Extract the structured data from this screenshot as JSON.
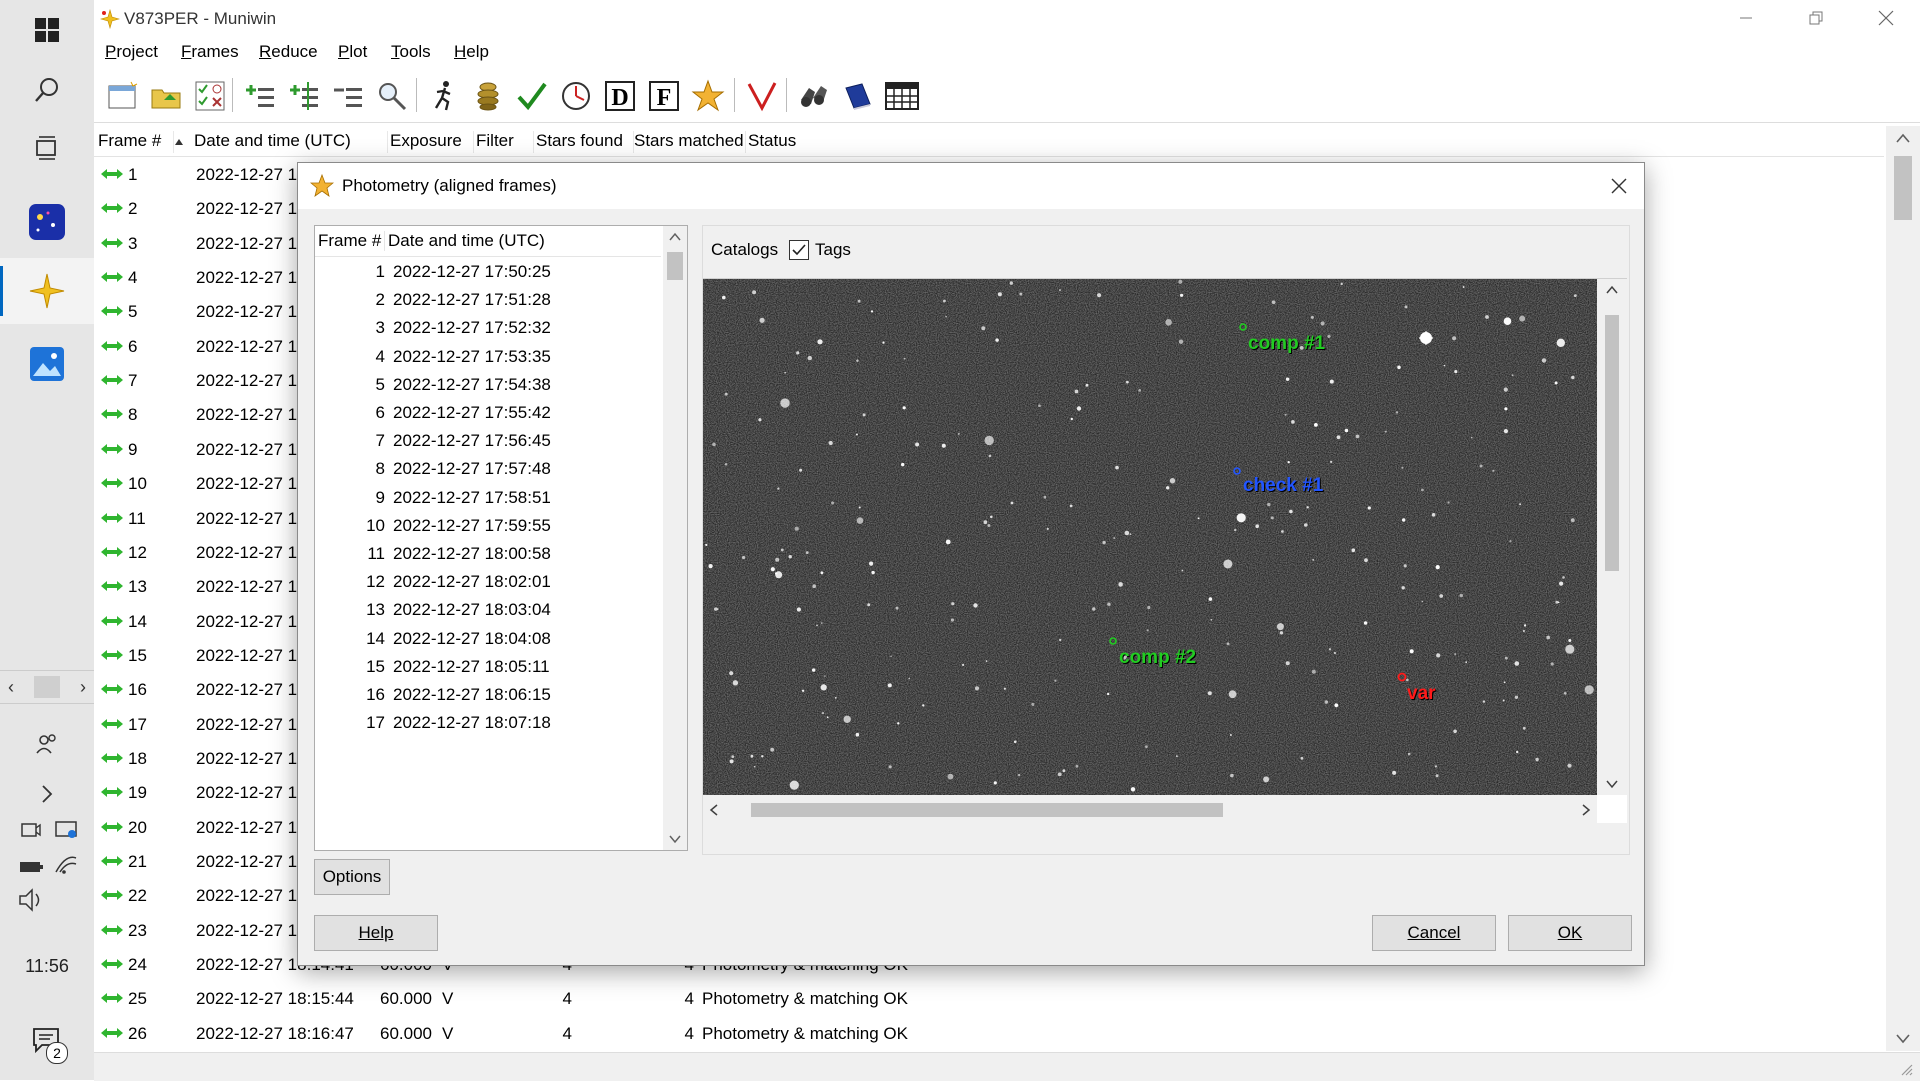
{
  "window": {
    "title": "V873PER - Muniwin",
    "menu": [
      {
        "label": "Project",
        "u": "P",
        "rest": "roject"
      },
      {
        "label": "Frames",
        "u": "F",
        "rest": "rames"
      },
      {
        "label": "Reduce",
        "u": "R",
        "rest": "educe"
      },
      {
        "label": "Plot",
        "u": "P",
        "rest": "lot"
      },
      {
        "label": "Tools",
        "u": "T",
        "rest": "ools"
      },
      {
        "label": "Help",
        "u": "H",
        "rest": "elp"
      }
    ]
  },
  "taskbar": {
    "clock": "11:56",
    "notification_count": "2"
  },
  "frames_table": {
    "headers": [
      "Frame #",
      "Date and time (UTC)",
      "Exposure",
      "Filter",
      "Stars found",
      "Stars matched",
      "Status"
    ],
    "rows": [
      {
        "frame": "1",
        "datetime": "2022-12-27 1",
        "exposure": "",
        "filter": "",
        "stars_found": "",
        "stars_matched": "",
        "status": ""
      },
      {
        "frame": "2",
        "datetime": "2022-12-27 1",
        "exposure": "",
        "filter": "",
        "stars_found": "",
        "stars_matched": "",
        "status": ""
      },
      {
        "frame": "3",
        "datetime": "2022-12-27 1",
        "exposure": "",
        "filter": "",
        "stars_found": "",
        "stars_matched": "",
        "status": ""
      },
      {
        "frame": "4",
        "datetime": "2022-12-27 1",
        "exposure": "",
        "filter": "",
        "stars_found": "",
        "stars_matched": "",
        "status": ""
      },
      {
        "frame": "5",
        "datetime": "2022-12-27 1",
        "exposure": "",
        "filter": "",
        "stars_found": "",
        "stars_matched": "",
        "status": ""
      },
      {
        "frame": "6",
        "datetime": "2022-12-27 1",
        "exposure": "",
        "filter": "",
        "stars_found": "",
        "stars_matched": "",
        "status": ""
      },
      {
        "frame": "7",
        "datetime": "2022-12-27 1",
        "exposure": "",
        "filter": "",
        "stars_found": "",
        "stars_matched": "",
        "status": ""
      },
      {
        "frame": "8",
        "datetime": "2022-12-27 1",
        "exposure": "",
        "filter": "",
        "stars_found": "",
        "stars_matched": "",
        "status": ""
      },
      {
        "frame": "9",
        "datetime": "2022-12-27 1",
        "exposure": "",
        "filter": "",
        "stars_found": "",
        "stars_matched": "",
        "status": ""
      },
      {
        "frame": "10",
        "datetime": "2022-12-27 1",
        "exposure": "",
        "filter": "",
        "stars_found": "",
        "stars_matched": "",
        "status": ""
      },
      {
        "frame": "11",
        "datetime": "2022-12-27 1",
        "exposure": "",
        "filter": "",
        "stars_found": "",
        "stars_matched": "",
        "status": ""
      },
      {
        "frame": "12",
        "datetime": "2022-12-27 1",
        "exposure": "",
        "filter": "",
        "stars_found": "",
        "stars_matched": "",
        "status": ""
      },
      {
        "frame": "13",
        "datetime": "2022-12-27 1",
        "exposure": "",
        "filter": "",
        "stars_found": "",
        "stars_matched": "",
        "status": ""
      },
      {
        "frame": "14",
        "datetime": "2022-12-27 1",
        "exposure": "",
        "filter": "",
        "stars_found": "",
        "stars_matched": "",
        "status": ""
      },
      {
        "frame": "15",
        "datetime": "2022-12-27 1",
        "exposure": "",
        "filter": "",
        "stars_found": "",
        "stars_matched": "",
        "status": ""
      },
      {
        "frame": "16",
        "datetime": "2022-12-27 1",
        "exposure": "",
        "filter": "",
        "stars_found": "",
        "stars_matched": "",
        "status": ""
      },
      {
        "frame": "17",
        "datetime": "2022-12-27 1",
        "exposure": "",
        "filter": "",
        "stars_found": "",
        "stars_matched": "",
        "status": ""
      },
      {
        "frame": "18",
        "datetime": "2022-12-27 1",
        "exposure": "",
        "filter": "",
        "stars_found": "",
        "stars_matched": "",
        "status": ""
      },
      {
        "frame": "19",
        "datetime": "2022-12-27 1",
        "exposure": "",
        "filter": "",
        "stars_found": "",
        "stars_matched": "",
        "status": ""
      },
      {
        "frame": "20",
        "datetime": "2022-12-27 1",
        "exposure": "",
        "filter": "",
        "stars_found": "",
        "stars_matched": "",
        "status": ""
      },
      {
        "frame": "21",
        "datetime": "2022-12-27 1",
        "exposure": "",
        "filter": "",
        "stars_found": "",
        "stars_matched": "",
        "status": ""
      },
      {
        "frame": "22",
        "datetime": "2022-12-27 1",
        "exposure": "",
        "filter": "",
        "stars_found": "",
        "stars_matched": "",
        "status": ""
      },
      {
        "frame": "23",
        "datetime": "2022-12-27 1",
        "exposure": "",
        "filter": "",
        "stars_found": "",
        "stars_matched": "",
        "status": ""
      },
      {
        "frame": "24",
        "datetime": "2022-12-27 18:14:41",
        "exposure": "60.000",
        "filter": "V",
        "stars_found": "4",
        "stars_matched": "4",
        "status": "Photometry & matching OK"
      },
      {
        "frame": "25",
        "datetime": "2022-12-27 18:15:44",
        "exposure": "60.000",
        "filter": "V",
        "stars_found": "4",
        "stars_matched": "4",
        "status": "Photometry & matching OK"
      },
      {
        "frame": "26",
        "datetime": "2022-12-27 18:16:47",
        "exposure": "60.000",
        "filter": "V",
        "stars_found": "4",
        "stars_matched": "4",
        "status": "Photometry & matching OK"
      }
    ]
  },
  "dialog": {
    "title": "Photometry (aligned frames)",
    "list_headers": [
      "Frame #",
      "Date and time (UTC)"
    ],
    "list_rows": [
      {
        "n": "1",
        "dt": "2022-12-27 17:50:25"
      },
      {
        "n": "2",
        "dt": "2022-12-27 17:51:28"
      },
      {
        "n": "3",
        "dt": "2022-12-27 17:52:32"
      },
      {
        "n": "4",
        "dt": "2022-12-27 17:53:35"
      },
      {
        "n": "5",
        "dt": "2022-12-27 17:54:38"
      },
      {
        "n": "6",
        "dt": "2022-12-27 17:55:42"
      },
      {
        "n": "7",
        "dt": "2022-12-27 17:56:45"
      },
      {
        "n": "8",
        "dt": "2022-12-27 17:57:48"
      },
      {
        "n": "9",
        "dt": "2022-12-27 17:58:51"
      },
      {
        "n": "10",
        "dt": "2022-12-27 17:59:55"
      },
      {
        "n": "11",
        "dt": "2022-12-27 18:00:58"
      },
      {
        "n": "12",
        "dt": "2022-12-27 18:02:01"
      },
      {
        "n": "13",
        "dt": "2022-12-27 18:03:04"
      },
      {
        "n": "14",
        "dt": "2022-12-27 18:04:08"
      },
      {
        "n": "15",
        "dt": "2022-12-27 18:05:11"
      },
      {
        "n": "16",
        "dt": "2022-12-27 18:06:15"
      },
      {
        "n": "17",
        "dt": "2022-12-27 18:07:18"
      }
    ],
    "catalogs_label": "Catalogs",
    "tags_label": "Tags",
    "tags_checked": true,
    "tags": [
      {
        "label": "comp #1",
        "color": "#22cc22"
      },
      {
        "label": "check #1",
        "color": "#2255ff"
      },
      {
        "label": "comp #2",
        "color": "#22cc22"
      },
      {
        "label": "var",
        "color": "#ff1a1a"
      }
    ],
    "options_label": "Options",
    "help_label": "Help",
    "cancel_label": "Cancel",
    "ok_label": "OK"
  },
  "colors": {
    "arrow_green": "#2fb52f",
    "accent": "#0067c0"
  }
}
